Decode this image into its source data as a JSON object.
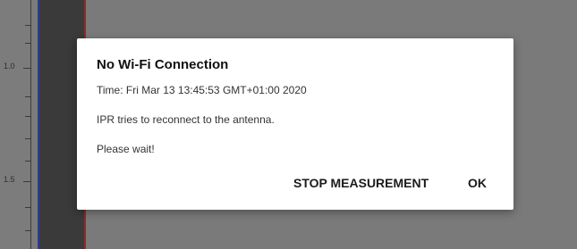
{
  "ruler": {
    "labels": [
      "1.0",
      "1.5"
    ]
  },
  "dialog": {
    "title": "No Wi-Fi Connection",
    "time_text": "Time: Fri Mar 13 13:45:53 GMT+01:00 2020",
    "message": "IPR tries to reconnect to the antenna.",
    "wait_text": "Please wait!",
    "stop_label": "STOP MEASUREMENT",
    "ok_label": "OK"
  }
}
